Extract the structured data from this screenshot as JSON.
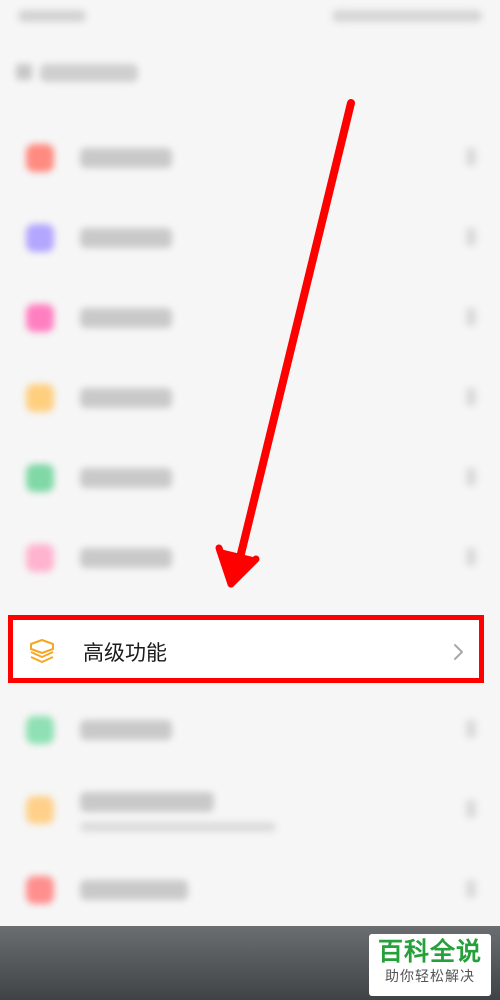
{
  "advanced_row": {
    "label": "高级功能",
    "icon": "layers-icon",
    "icon_color": "#f5a623",
    "chevron_icon": "chevron-right-icon"
  },
  "annotation": {
    "highlight_color": "#ff0000",
    "arrow_color": "#ff0000"
  },
  "watermark": {
    "title": "百科全说",
    "subtitle": "助你轻松解决",
    "title_color": "#26a03a"
  },
  "blurred_rows": [
    {
      "icon": "settings-icon",
      "icon_color": "#ff8a80"
    },
    {
      "icon": "grid-icon",
      "icon_color": "#b3a6ff"
    },
    {
      "icon": "star-icon",
      "icon_color": "#ff80c0"
    },
    {
      "icon": "bell-icon",
      "icon_color": "#ffcf80"
    },
    {
      "icon": "shield-icon",
      "icon_color": "#80d8a6"
    },
    {
      "icon": "heart-icon",
      "icon_color": "#ffb3cf"
    },
    {
      "icon": "leaf-icon",
      "icon_color": "#8fe0b4"
    },
    {
      "icon": "bookmark-icon",
      "icon_color": "#ffd08a"
    },
    {
      "icon": "info-icon",
      "icon_color": "#ff8f8f"
    }
  ]
}
